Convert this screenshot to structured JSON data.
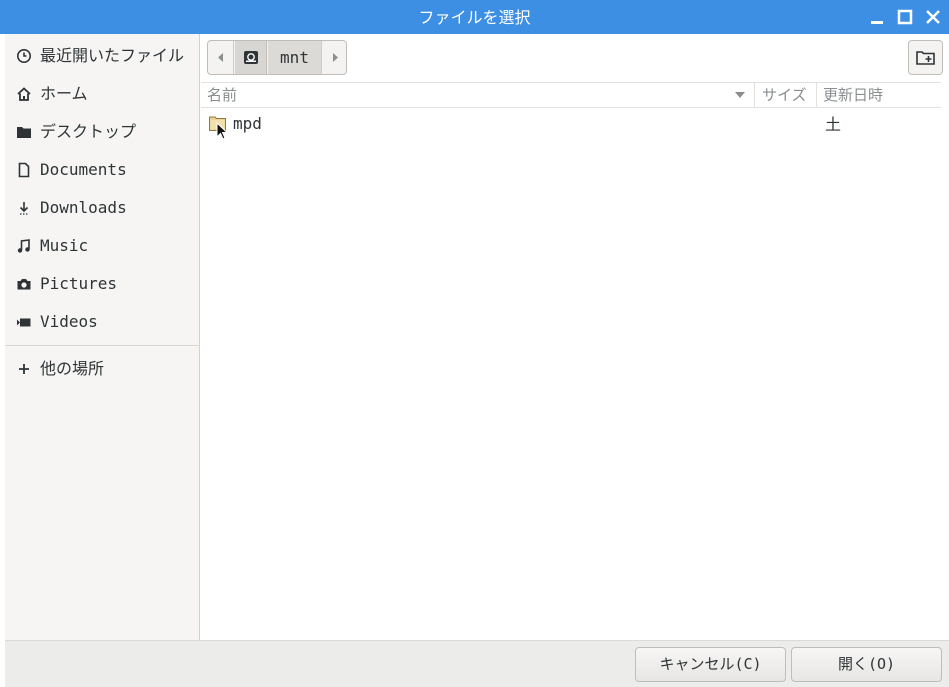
{
  "window": {
    "title": "ファイルを選択"
  },
  "sidebar": {
    "items": [
      {
        "label": "最近開いたファイル",
        "icon": "clock-icon"
      },
      {
        "label": "ホーム",
        "icon": "home-icon"
      },
      {
        "label": "デスクトップ",
        "icon": "folder-icon"
      },
      {
        "label": "Documents",
        "icon": "document-icon"
      },
      {
        "label": "Downloads",
        "icon": "download-icon"
      },
      {
        "label": "Music",
        "icon": "music-icon"
      },
      {
        "label": "Pictures",
        "icon": "camera-icon"
      },
      {
        "label": "Videos",
        "icon": "video-icon"
      }
    ],
    "other_locations": {
      "label": "他の場所",
      "icon": "plus-icon"
    }
  },
  "pathbar": {
    "segments": [
      "mnt"
    ],
    "drive_icon": "drive-icon"
  },
  "columns": {
    "name": "名前",
    "size": "サイズ",
    "modified": "更新日時"
  },
  "files": [
    {
      "name": "mpd",
      "size": "",
      "modified": "土",
      "icon": "folder-icon"
    }
  ],
  "buttons": {
    "cancel": "キャンセル(C)",
    "open": "開く(O)"
  }
}
